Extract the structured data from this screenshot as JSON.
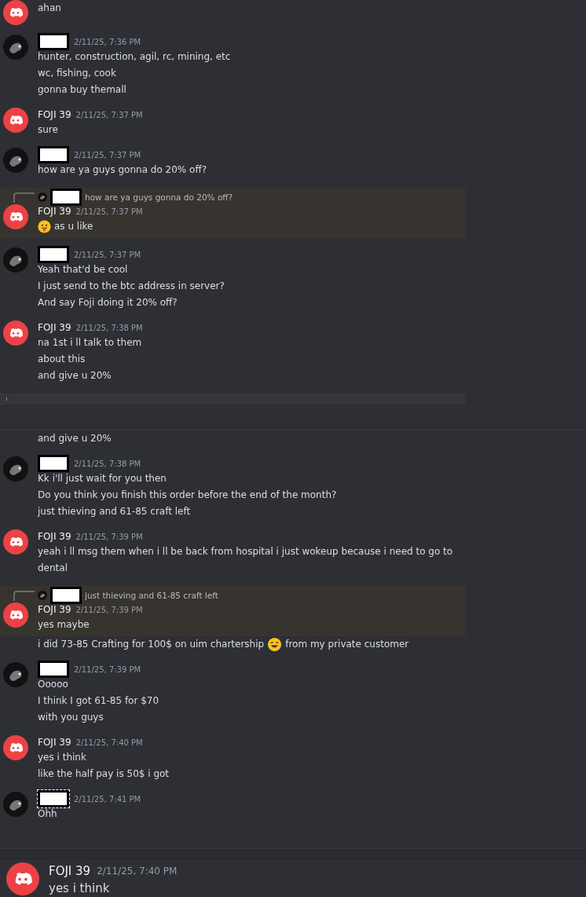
{
  "messages": [
    {
      "kind": "message",
      "author": {
        "kind": "bot"
      },
      "lines": [
        "ahan"
      ]
    },
    {
      "kind": "message",
      "author": {
        "kind": "user"
      },
      "timestamp": "2/11/25, 7:36 PM",
      "lines": [
        "hunter, construction, agil, rc, mining, etc",
        "wc, fishing, cook",
        "gonna buy themall"
      ]
    },
    {
      "kind": "message",
      "author": {
        "kind": "bot",
        "name": "FOJI 39"
      },
      "timestamp": "2/11/25, 7:37 PM",
      "lines": [
        "sure"
      ]
    },
    {
      "kind": "message",
      "author": {
        "kind": "user"
      },
      "timestamp": "2/11/25, 7:37 PM",
      "lines": [
        "how are ya guys gonna do 20% off?"
      ]
    },
    {
      "kind": "message",
      "highlighted": true,
      "reply": {
        "text": "how are ya guys gonna do 20% off?"
      },
      "author": {
        "kind": "bot",
        "name": "FOJI 39"
      },
      "timestamp": "2/11/25, 7:37 PM",
      "lines": [
        [
          {
            "kind": "emoji_tongue"
          },
          {
            "kind": "text",
            "text": "as u like"
          }
        ]
      ]
    },
    {
      "kind": "message",
      "author": {
        "kind": "user"
      },
      "timestamp": "2/11/25, 7:37 PM",
      "lines": [
        "Yeah that'd be cool",
        "I just send to the btc address in server?",
        "And say Foji doing it 20% off?"
      ]
    },
    {
      "kind": "message",
      "author": {
        "kind": "bot",
        "name": "FOJI 39"
      },
      "timestamp": "2/11/25, 7:38 PM",
      "lines": [
        "na 1st i ll talk to them",
        "about this",
        "and give u 20%"
      ]
    },
    {
      "kind": "band"
    },
    {
      "kind": "continuation",
      "lines": [
        "and give u 20%"
      ]
    },
    {
      "kind": "message",
      "author": {
        "kind": "user"
      },
      "timestamp": "2/11/25, 7:38 PM",
      "lines": [
        "Kk i'll just wait for you then",
        "Do you think you finish this order before the end of the month?",
        "just thieving and 61-85 craft left"
      ]
    },
    {
      "kind": "message",
      "author": {
        "kind": "bot",
        "name": "FOJI 39"
      },
      "timestamp": "2/11/25, 7:39 PM",
      "lines": [
        "yeah i ll msg them when i ll be back from hospital i just wokeup because i need to go to dental"
      ]
    },
    {
      "kind": "message",
      "highlighted": true,
      "reply": {
        "text": "just thieving and 61-85 craft left"
      },
      "author": {
        "kind": "bot",
        "name": "FOJI 39"
      },
      "timestamp": "2/11/25, 7:39 PM",
      "lines": [
        "yes maybe"
      ]
    },
    {
      "kind": "continuation",
      "lines": [
        [
          {
            "kind": "text",
            "text": "i did 73-85 Crafting for 100$ on uim chartership"
          },
          {
            "kind": "emoji_laugh"
          },
          {
            "kind": "text",
            "text": "from my private customer"
          }
        ]
      ]
    },
    {
      "kind": "message",
      "author": {
        "kind": "user"
      },
      "timestamp": "2/11/25, 7:39 PM",
      "lines": [
        "Ooooo",
        "I think I got 61-85 for $70",
        "with you guys"
      ]
    },
    {
      "kind": "message",
      "author": {
        "kind": "bot",
        "name": "FOJI 39"
      },
      "timestamp": "2/11/25, 7:40 PM",
      "lines": [
        "yes i think",
        "like the half pay is 50$ i got"
      ]
    },
    {
      "kind": "message",
      "author": {
        "kind": "user",
        "selected": true
      },
      "timestamp": "2/11/25, 7:41 PM",
      "lines": [
        "Ohh"
      ]
    }
  ],
  "preview": {
    "author": {
      "kind": "bot",
      "name": "FOJI 39"
    },
    "timestamp": "2/11/25, 7:40 PM",
    "lines": [
      "yes i think"
    ]
  }
}
